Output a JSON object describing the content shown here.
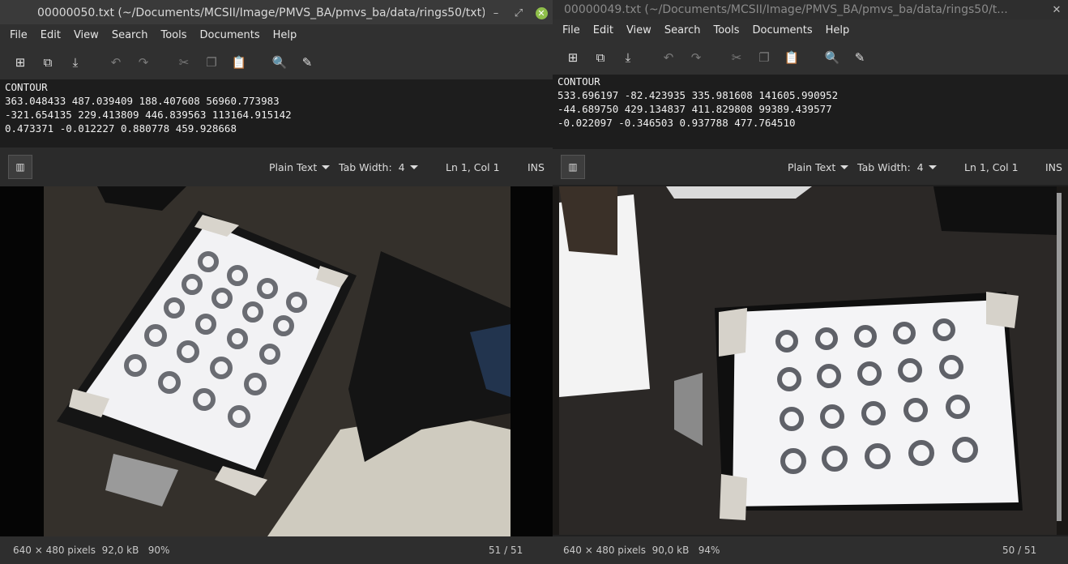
{
  "left_window": {
    "title": "00000050.txt (~/Documents/MCSII/Image/PMVS_BA/pmvs_ba/data/rings50/txt)",
    "menu": [
      "File",
      "Edit",
      "View",
      "Search",
      "Tools",
      "Documents",
      "Help"
    ],
    "lines": [
      "CONTOUR",
      "363.048433 487.039409 188.407608 56960.773983",
      "-321.654135 229.413809 446.839563 113164.915142",
      "0.473371 -0.012227 0.880778 459.928668"
    ],
    "status": {
      "language": "Plain Text",
      "tab_width": "Tab Width:  4",
      "position": "Ln 1, Col 1",
      "mode": "INS"
    }
  },
  "right_window": {
    "title": "00000049.txt (~/Documents/MCSII/Image/PMVS_BA/pmvs_ba/data/rings50/t...",
    "menu": [
      "File",
      "Edit",
      "View",
      "Search",
      "Tools",
      "Documents",
      "Help"
    ],
    "lines": [
      "CONTOUR",
      "533.696197 -82.423935 335.981608 141605.990952",
      "-44.689750 429.134837 411.829808 99389.439577",
      "-0.022097 -0.346503 0.937788 477.764510"
    ],
    "status": {
      "language": "Plain Text",
      "tab_width": "Tab Width:  4",
      "position": "Ln 1, Col 1",
      "mode": "INS"
    }
  },
  "left_viewer": {
    "info": "640 × 480 pixels  92,0 kB   90%",
    "counter": "51 / 51"
  },
  "right_viewer": {
    "info": "640 × 480 pixels  90,0 kB   94%",
    "counter": "50 / 51"
  },
  "toolbar_icons": [
    "new-document-icon",
    "open-document-icon",
    "save-icon",
    "undo-icon",
    "redo-icon",
    "cut-icon",
    "copy-icon",
    "paste-icon",
    "search-icon",
    "replace-icon"
  ],
  "colors": {
    "close_button": "#8fbf4a",
    "editor_bg": "#1d1d1d"
  }
}
